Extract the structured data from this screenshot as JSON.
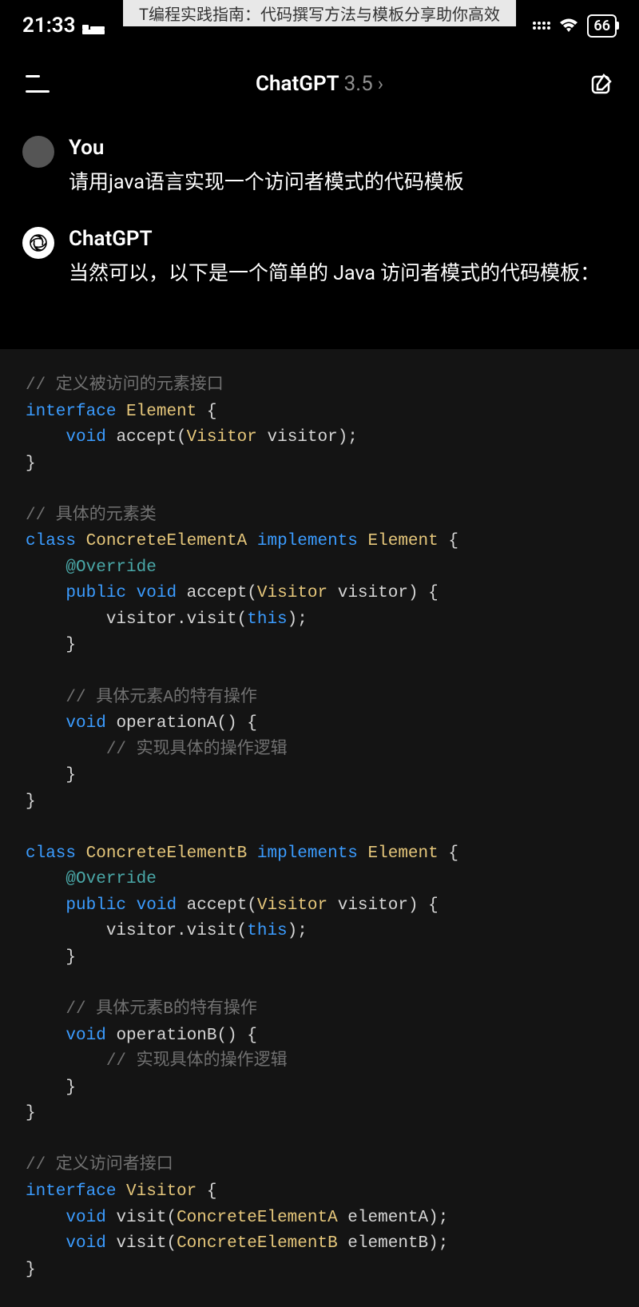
{
  "banner": "T编程实践指南：代码撰写方法与模板分享助你高效",
  "status": {
    "time": "21:33",
    "battery": "66"
  },
  "header": {
    "title_main": "ChatGPT",
    "title_version": "3.5",
    "chevron": "›"
  },
  "messages": {
    "user": {
      "name": "You",
      "text": "请用java语言实现一个访问者模式的代码模板"
    },
    "assistant": {
      "name": "ChatGPT",
      "text": "当然可以，以下是一个简单的 Java 访问者模式的代码模板："
    }
  },
  "code": {
    "c1": "// 定义被访问的元素接口",
    "l2a": "interface",
    "l2b": "Element",
    "l2c": " {",
    "l3a": "void",
    "l3b": " accept(",
    "l3c": "Visitor",
    "l3d": " visitor);",
    "l4": "}",
    "c2": "// 具体的元素类",
    "l6a": "class",
    "l6b": "ConcreteElementA",
    "l6c": "implements",
    "l6d": "Element",
    "l6e": " {",
    "l7": "@Override",
    "l8a": "public",
    "l8b": "void",
    "l8c": " accept(",
    "l8d": "Visitor",
    "l8e": " visitor) {",
    "l9a": "        visitor.visit(",
    "l9b": "this",
    "l9c": ");",
    "l10": "    }",
    "c3": "    // 具体元素A的特有操作",
    "l12a": "void",
    "l12b": " operationA() {",
    "c4": "        // 实现具体的操作逻辑",
    "l14": "    }",
    "l15": "}",
    "l17a": "class",
    "l17b": "ConcreteElementB",
    "l17c": "implements",
    "l17d": "Element",
    "l17e": " {",
    "l18": "@Override",
    "l19a": "public",
    "l19b": "void",
    "l19c": " accept(",
    "l19d": "Visitor",
    "l19e": " visitor) {",
    "l20a": "        visitor.visit(",
    "l20b": "this",
    "l20c": ");",
    "l21": "    }",
    "c5": "    // 具体元素B的特有操作",
    "l23a": "void",
    "l23b": " operationB() {",
    "c6": "        // 实现具体的操作逻辑",
    "l25": "    }",
    "l26": "}",
    "c7": "// 定义访问者接口",
    "l28a": "interface",
    "l28b": "Visitor",
    "l28c": " {",
    "l29a": "void",
    "l29b": " visit(",
    "l29c": "ConcreteElementA",
    "l29d": " elementA);",
    "l30a": "void",
    "l30b": " visit(",
    "l30c": "ConcreteElementB",
    "l30d": " elementB);",
    "l31": "}"
  }
}
